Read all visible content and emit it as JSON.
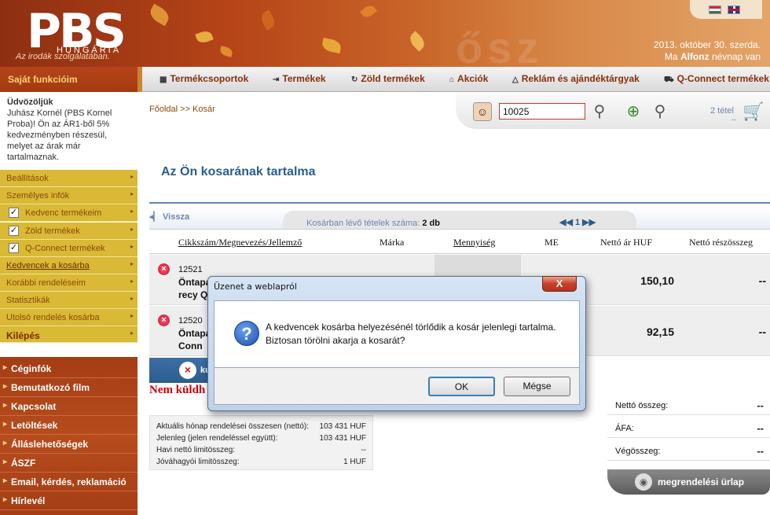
{
  "header": {
    "logo_text": "PBS",
    "logo_sub": "HUNGÁRIA",
    "tagline": "Az irodák szolgálatában.",
    "watermark": "ősz",
    "date": "2013. október 30. szerda.",
    "nameday_prefix": "Ma",
    "nameday_name": "Alfonz",
    "nameday_suffix": "névnap van"
  },
  "sidebar": {
    "title": "Saját funkcióim",
    "welcome_title": "Üdvözöljük",
    "welcome_text": "Juhász Kornél (PBS Kornel Proba)! Ön az ÁR1-ből 5% kedvezményben részesül, melyet az árak már tartalmaznak.",
    "items": [
      {
        "label": "Beállítások"
      },
      {
        "label": "Személyes infók"
      },
      {
        "label": "Kedvenc termékeim"
      },
      {
        "label": "Zöld termékek"
      },
      {
        "label": "Q-Connect termékek"
      },
      {
        "label": "Kedvencek a kosárba"
      },
      {
        "label": "Korábbi rendeléseim"
      },
      {
        "label": "Statisztikák"
      },
      {
        "label": "Utolsó rendelés kosárba"
      },
      {
        "label": "Kilépés"
      }
    ],
    "links": [
      {
        "label": "Céginfók"
      },
      {
        "label": "Bemutatkozó film"
      },
      {
        "label": "Kapcsolat"
      },
      {
        "label": "Letöltések"
      },
      {
        "label": "Álláslehetőségek"
      },
      {
        "label": "ÁSZF"
      },
      {
        "label": "Email, kérdés, reklamáció"
      },
      {
        "label": "Hírlevél"
      }
    ]
  },
  "topnav": {
    "items": [
      {
        "label": "Termékcsoportok",
        "icon": "grid-icon"
      },
      {
        "label": "Termékek",
        "icon": "arrow-box-icon"
      },
      {
        "label": "Zöld termékek",
        "icon": "recycle-icon"
      },
      {
        "label": "Akciók",
        "icon": "tag-icon"
      },
      {
        "label": "Reklám és ajándéktárgyak",
        "icon": "warning-icon"
      },
      {
        "label": "Q-Connect termékek",
        "icon": "cart-icon"
      }
    ]
  },
  "breadcrumb": "Főoldal >> Kosár",
  "search": {
    "value": "10025"
  },
  "cart": {
    "count": "2 tétel",
    "dash": "--"
  },
  "main": {
    "title": "Az Ön kosarának tartalma",
    "back": "Vissza",
    "count_label": "Kosárban lévő tételek száma:",
    "count_value": "2 db",
    "page": "1",
    "columns": [
      "Cikkszám/Megnevezés/Jellemző",
      "Márka",
      "Mennyiség",
      "ME",
      "Nettó ár HUF",
      "Nettó részösszeg"
    ],
    "rows": [
      {
        "code": "12521",
        "name": "Öntapa recy Q",
        "price": "150,10",
        "total": "--"
      },
      {
        "code": "12520",
        "name": "Öntapa Q-Conn",
        "price": "92,15",
        "total": "--"
      }
    ],
    "remove_label": "ku",
    "not_sent": "Nem küldh"
  },
  "limits": [
    {
      "label": "Aktuális hónap rendelései összesen (nettó):",
      "value": "103 431 HUF"
    },
    {
      "label": "Jelenleg (jelen rendeléssel együtt):",
      "value": "103 431 HUF"
    },
    {
      "label": "Havi nettó limitösszeg:",
      "value": "--"
    },
    {
      "label": "Jóváhagyói limitösszeg:",
      "value": "1 HUF"
    }
  ],
  "totals": [
    {
      "label": "Nettó összeg:",
      "value": "--"
    },
    {
      "label": "ÁFA:",
      "value": "--"
    },
    {
      "label": "Végösszeg:",
      "value": "--"
    }
  ],
  "order_form": "megrendelési ürlap",
  "dialog": {
    "title": "Üzenet a weblapról",
    "close": "X",
    "line1": "A kedvencek kosárba helyezésénél törlődik a kosár jelenlegi tartalma.",
    "line2": "Biztosan törölni akarja a kosarát?",
    "ok": "OK",
    "cancel": "Mégse"
  },
  "colors": {
    "header_bg": "#b64418",
    "sidebar_yellow": "#d9b935",
    "accent_blue": "#2a5d8e",
    "alert_red": "#c00000"
  }
}
